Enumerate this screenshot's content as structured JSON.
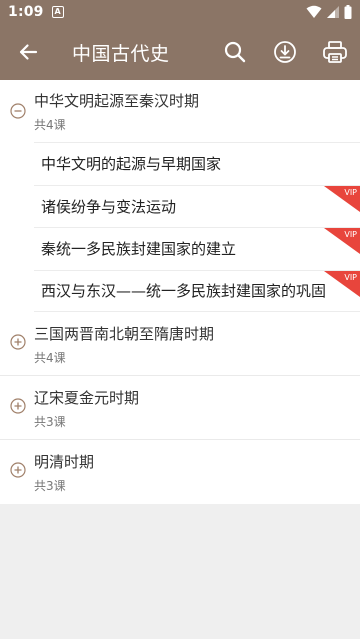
{
  "status": {
    "time": "1:09",
    "app_icon_letter": "A"
  },
  "appbar": {
    "title": "中国古代史"
  },
  "chapters": [
    {
      "title": "中华文明起源至秦汉时期",
      "count": "共4课",
      "lessons": [
        {
          "title": "中华文明的起源与早期国家"
        },
        {
          "title": "诸侯纷争与变法运动",
          "badge": "VIP"
        },
        {
          "title": "秦统一多民族封建国家的建立",
          "badge": "VIP"
        },
        {
          "title": "西汉与东汉——统一多民族封建国家的巩固",
          "badge": "VIP"
        }
      ]
    },
    {
      "title": "三国两晋南北朝至隋唐时期",
      "count": "共4课"
    },
    {
      "title": "辽宋夏金元时期",
      "count": "共3课"
    },
    {
      "title": "明清时期",
      "count": "共3课"
    }
  ],
  "colors": {
    "primary": "#8b7566",
    "vip": "#e8453c",
    "icon": "#a0806a"
  },
  "icons": [
    "arrow-left-icon",
    "search-icon",
    "download-icon",
    "print-icon",
    "minus-circle-icon",
    "plus-circle-icon"
  ]
}
